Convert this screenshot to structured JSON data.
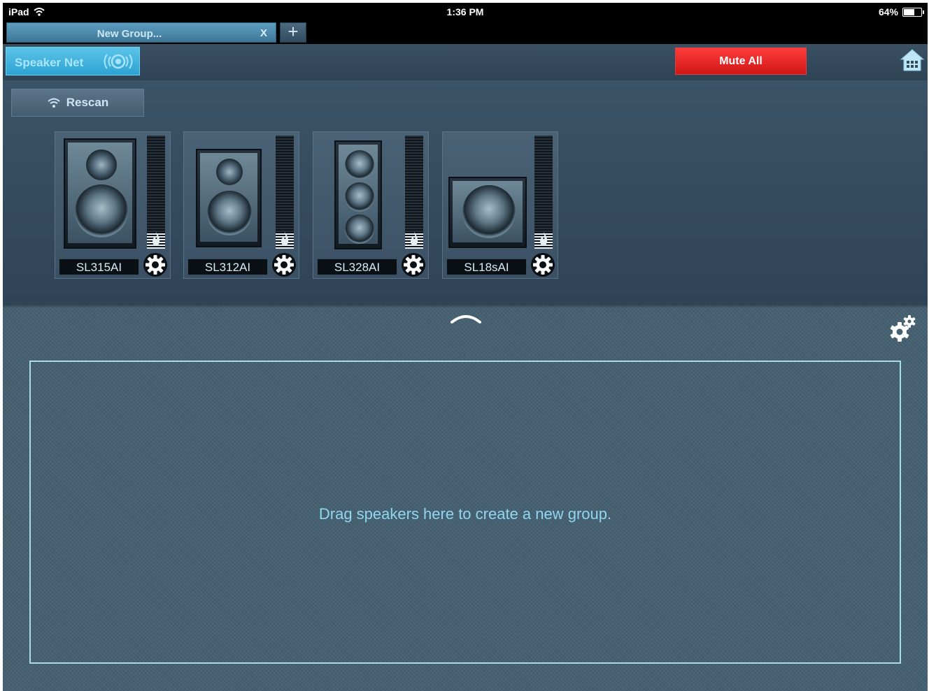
{
  "status_bar": {
    "device": "iPad",
    "time": "1:36 PM",
    "battery": "64%",
    "battery_level": 0.64,
    "icons": [
      "wifi-icon",
      "battery-icon"
    ]
  },
  "tabs": {
    "active_label": "New Group...",
    "close_label": "X",
    "add_label": "+"
  },
  "toolbar": {
    "speaker_net_label": "Speaker Net",
    "mute_all_label": "Mute All",
    "home_icon": "home-icon"
  },
  "speaker_panel": {
    "rescan_label": "Rescan",
    "speakers": [
      {
        "name": "SL315AI",
        "cabinet": "two-way-15"
      },
      {
        "name": "SL312AI",
        "cabinet": "two-way-12"
      },
      {
        "name": "SL328AI",
        "cabinet": "column-three"
      },
      {
        "name": "SL18sAI",
        "cabinet": "subwoofer"
      }
    ]
  },
  "drop_zone": {
    "message": "Drag speakers here to create a new group."
  },
  "colors": {
    "accent": "#2da3d2",
    "mute": "#e02020",
    "dropzone_text": "#8fd6ee"
  }
}
